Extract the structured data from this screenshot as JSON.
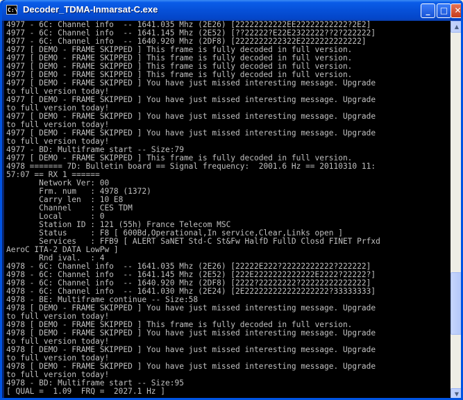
{
  "window": {
    "title": "Decoder_TDMA-Inmarsat-C.exe",
    "icon_label": "C:\\",
    "buttons": {
      "minimize": "_",
      "maximize": "□",
      "close": "✕"
    }
  },
  "console": {
    "lines": [
      "4977 - 6C: Channel info  -- 1641.035 Mhz (2E26) [22222222222EE22222222222?2E2]",
      "4977 - 6C: Channel info  -- 1641.145 Mhz (2E52) [??22222?E22E2322222??2?222222]",
      "4977 - 6C: Channel info  -- 1640.920 Mhz (2DF8) [2222222222322E2222222222222]",
      "4977 [ DEMO - FRAME SKIPPED ] This frame is fully decoded in full version.",
      "4977 [ DEMO - FRAME SKIPPED ] This frame is fully decoded in full version.",
      "4977 [ DEMO - FRAME SKIPPED ] This frame is fully decoded in full version.",
      "4977 [ DEMO - FRAME SKIPPED ] This frame is fully decoded in full version.",
      "4977 [ DEMO - FRAME SKIPPED ] You have just missed interesting message. Upgrade",
      "to full version today!",
      "4977 [ DEMO - FRAME SKIPPED ] You have just missed interesting message. Upgrade",
      "to full version today!",
      "4977 [ DEMO - FRAME SKIPPED ] You have just missed interesting message. Upgrade",
      "to full version today!",
      "4977 [ DEMO - FRAME SKIPPED ] You have just missed interesting message. Upgrade",
      "to full version today!",
      "4977 - BD: Multiframe start -- Size:79",
      "4977 [ DEMO - FRAME SKIPPED ] This frame is fully decoded in full version.",
      "4978 ======= 7D: Bulletin board == Signal frequency:  2001.6 Hz == 20110310 11:",
      "57:07 == RX 1 ======",
      "       Network Ver: 00",
      "       Frm. num   : 4978 (1372)",
      "       Carry len  : 10 E8",
      "       Channel    : CES TDM",
      "       Local      : 0",
      "       Station ID : 121 (55h) France Telecom MSC",
      "       Status     : F8 [ 600Bd,Operational,In service,Clear,Links open ]",
      "       Services   : FFB9 [ ALERT SaNET Std-C St&Fw HalfD FullD Closd FINET Prfxd",
      "AeroC ITA-2 DATA LowPw ]",
      "       Rnd ival.  : 4",
      "4978 - 6C: Channel info  -- 1641.035 Mhz (2E26) [22222E222?22222222222?222222]",
      "4978 - 6C: Channel info  -- 1641.145 Mhz (2E52) [222E2222222222222E2222?22222?]",
      "4978 - 6C: Channel info  -- 1640.920 Mhz (2DF8) [2222?22222222?22222222222222]",
      "4978 - 6C: Channel info  -- 1641.030 Mhz (2E24) [2E222222222222222222?33333333]",
      "4978 - BE: Multiframe continue -- Size:58",
      "4978 [ DEMO - FRAME SKIPPED ] You have just missed interesting message. Upgrade",
      "to full version today!",
      "4978 [ DEMO - FRAME SKIPPED ] This frame is fully decoded in full version.",
      "4978 [ DEMO - FRAME SKIPPED ] You have just missed interesting message. Upgrade",
      "to full version today!",
      "4978 [ DEMO - FRAME SKIPPED ] You have just missed interesting message. Upgrade",
      "to full version today!",
      "4978 [ DEMO - FRAME SKIPPED ] You have just missed interesting message. Upgrade",
      "to full version today!",
      "4978 - BD: Multiframe start -- Size:95",
      "[ QUAL =  1.09  FRQ =  2027.1 Hz ]"
    ]
  },
  "scrollbar": {
    "up_arrow": "▲",
    "down_arrow": "▼"
  }
}
